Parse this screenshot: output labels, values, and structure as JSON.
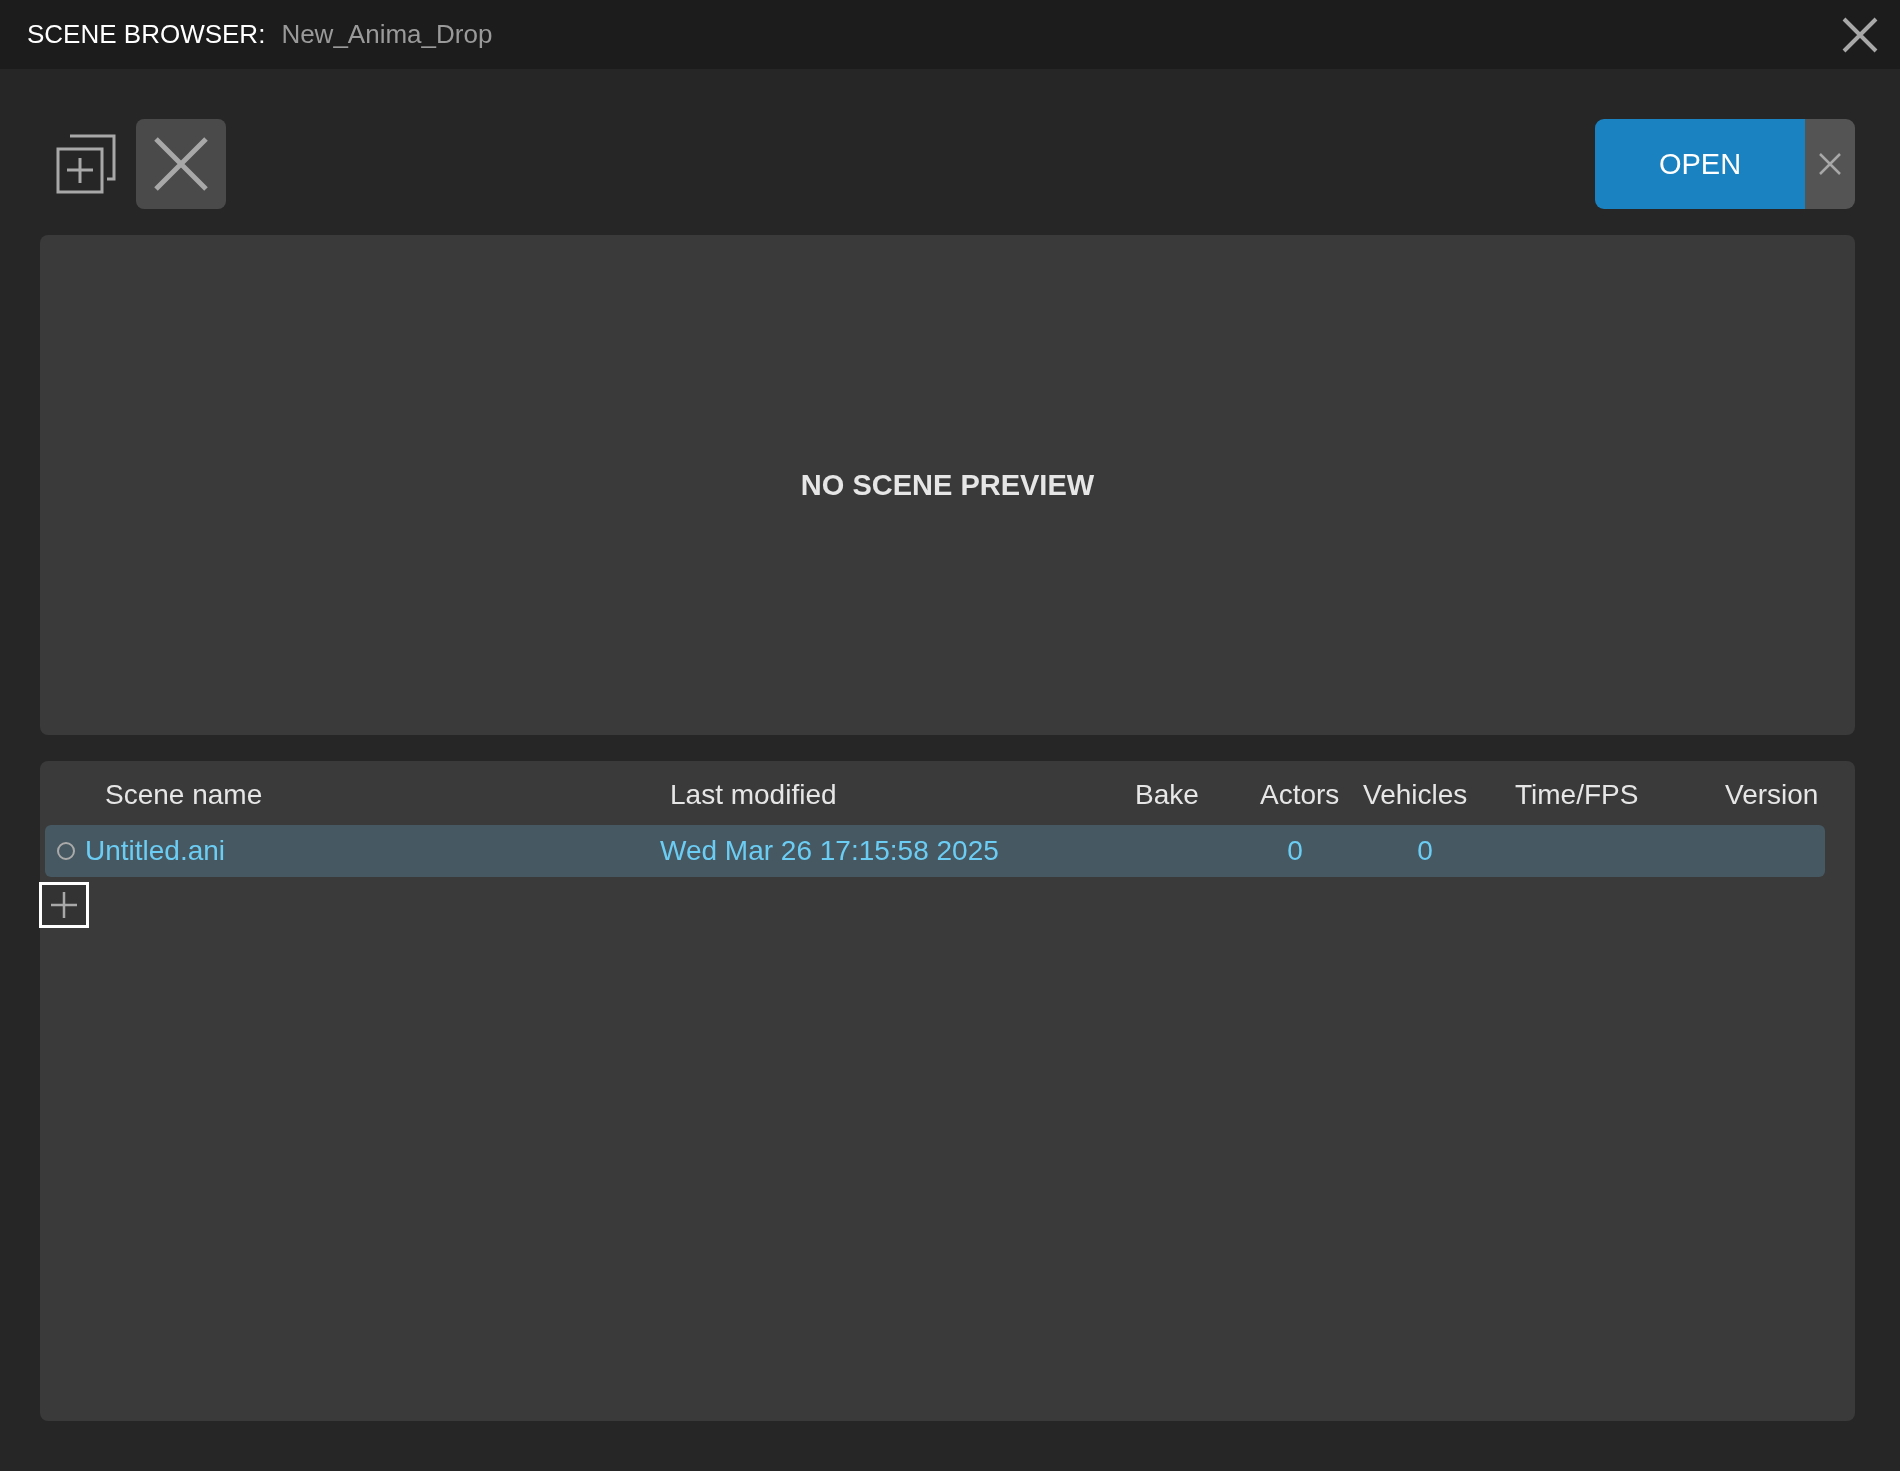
{
  "window": {
    "title": "SCENE BROWSER:",
    "subtitle": "New_Anima_Drop"
  },
  "toolbar": {
    "open_button": "OPEN"
  },
  "preview": {
    "message": "NO SCENE PREVIEW"
  },
  "table": {
    "columns": [
      "Scene name",
      "Last modified",
      "Bake",
      "Actors",
      "Vehicles",
      "Time/FPS",
      "Version"
    ],
    "rows": [
      {
        "selected": true,
        "checked": false,
        "cells": [
          "Untitled.ani",
          "Wed Mar 26 17:15:58 2025",
          "",
          "0",
          "0",
          "",
          ""
        ]
      }
    ]
  }
}
